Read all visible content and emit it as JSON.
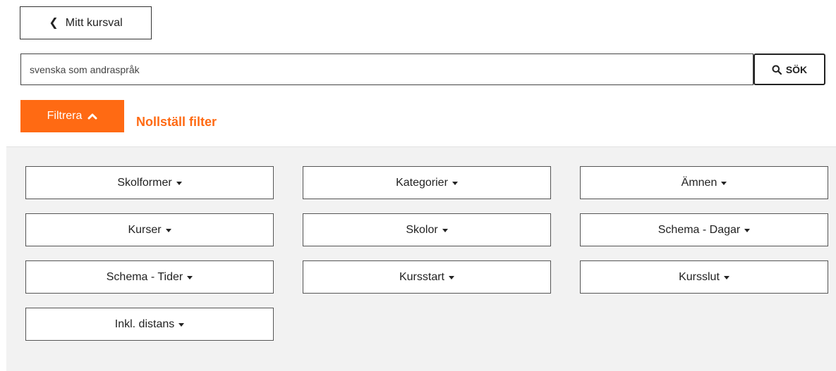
{
  "back_button": {
    "label": "Mitt kursval"
  },
  "search": {
    "value": "svenska som andraspråk",
    "button_label": "SÖK"
  },
  "filter": {
    "toggle_label": "Filtrera",
    "reset_label": "Nollställ filter"
  },
  "dropdowns": [
    {
      "label": "Skolformer"
    },
    {
      "label": "Kategorier"
    },
    {
      "label": "Ämnen"
    },
    {
      "label": "Kurser"
    },
    {
      "label": "Skolor"
    },
    {
      "label": "Schema - Dagar"
    },
    {
      "label": "Schema - Tider"
    },
    {
      "label": "Kursstart"
    },
    {
      "label": "Kursslut"
    },
    {
      "label": "Inkl. distans"
    }
  ],
  "colors": {
    "accent": "#ff6a13",
    "panel_background": "#f2f2f2"
  }
}
